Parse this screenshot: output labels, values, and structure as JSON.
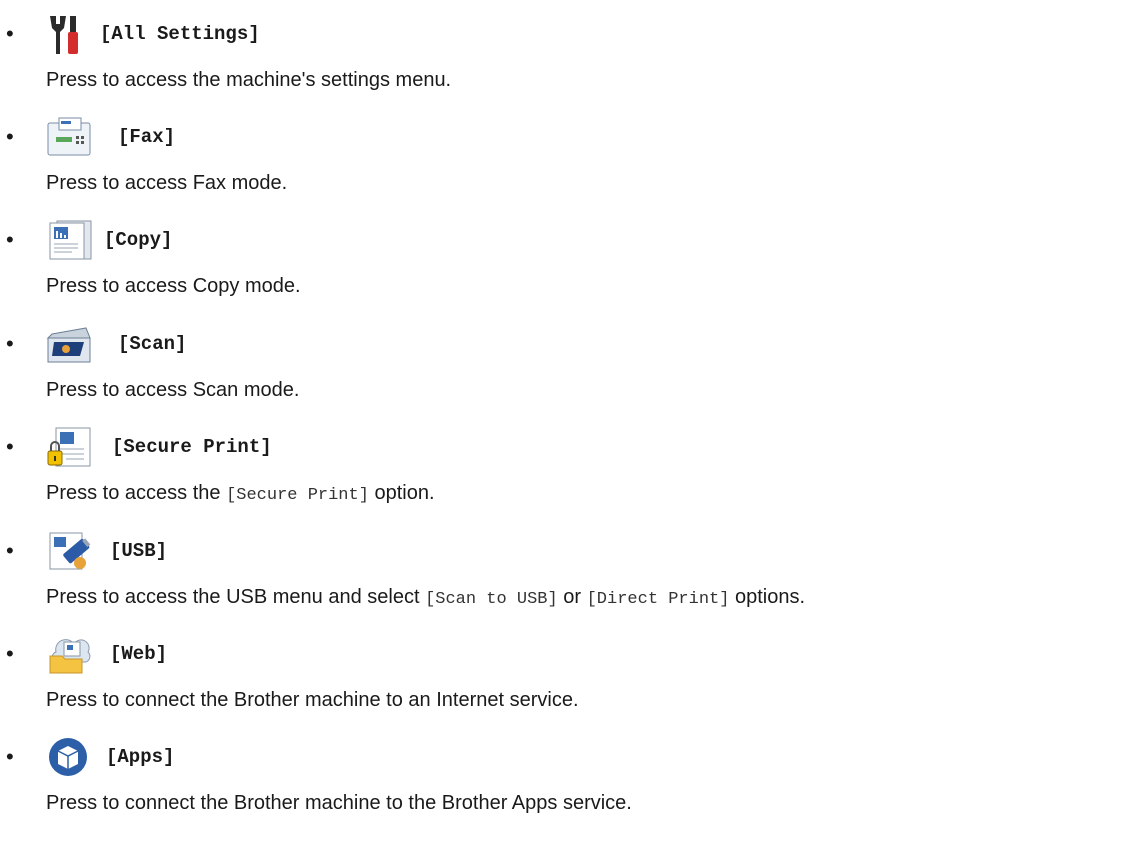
{
  "items": [
    {
      "icon": "tools-icon",
      "label": "[All Settings]",
      "desc": "Press to access the machine's settings menu."
    },
    {
      "icon": "fax-icon",
      "label": "[Fax]",
      "desc": "Press to access Fax mode."
    },
    {
      "icon": "copy-icon",
      "label": "[Copy]",
      "desc": "Press to access Copy mode."
    },
    {
      "icon": "scan-icon",
      "label": "[Scan]",
      "desc": "Press to access Scan mode."
    },
    {
      "icon": "secure-print-icon",
      "label": "[Secure Print]",
      "desc_parts": [
        "Press to access the ",
        "[Secure Print]",
        " option."
      ]
    },
    {
      "icon": "usb-icon",
      "label": "[USB]",
      "desc_parts": [
        "Press to access the USB menu and select ",
        "[Scan to USB]",
        " or ",
        "[Direct Print]",
        " options."
      ]
    },
    {
      "icon": "web-icon",
      "label": "[Web]",
      "desc": "Press to connect the Brother machine to an Internet service."
    },
    {
      "icon": "apps-icon",
      "label": "[Apps]",
      "desc": "Press to connect the Brother machine to the Brother Apps service."
    }
  ]
}
